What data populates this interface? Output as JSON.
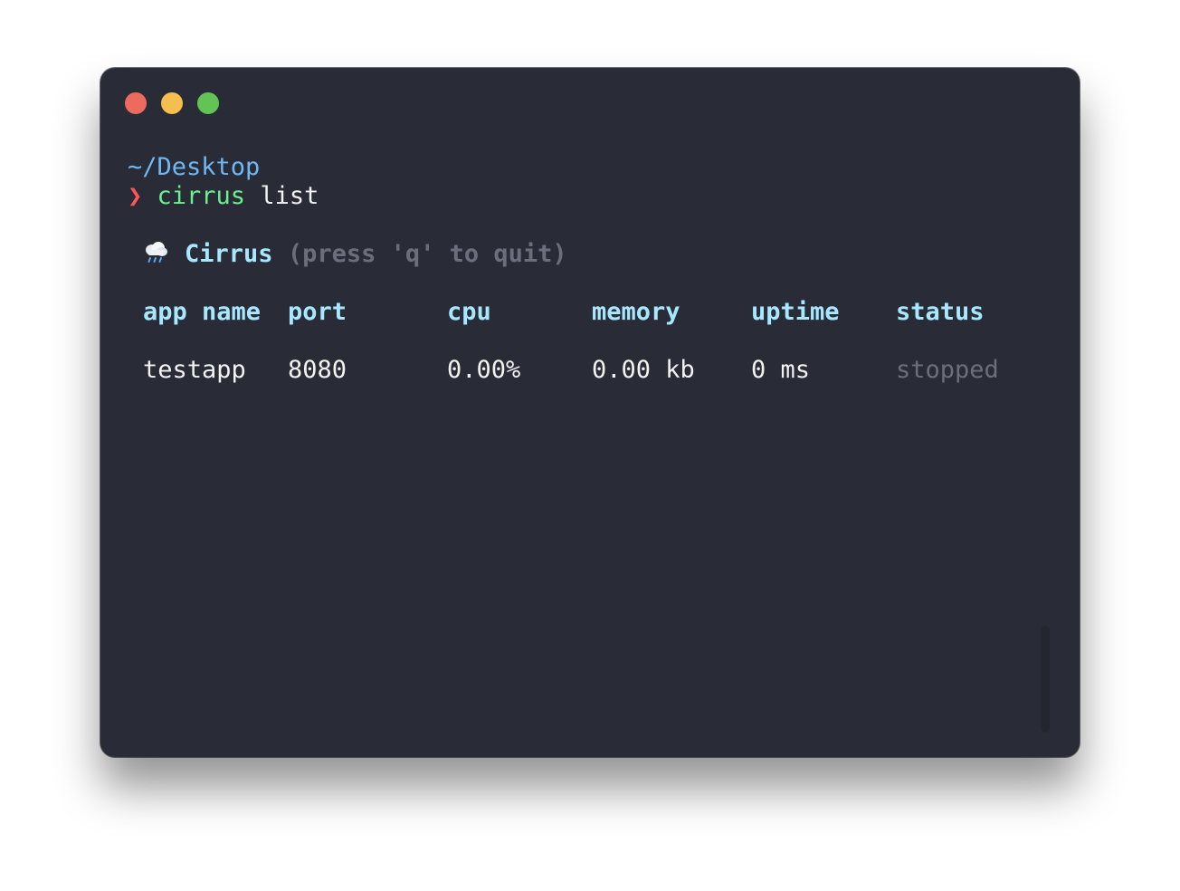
{
  "window": {
    "colors": {
      "background": "#292b37",
      "close": "#ed6a5e",
      "minimize": "#f5bf4f",
      "maximize": "#61c454"
    }
  },
  "terminal": {
    "cwd": "~/Desktop",
    "prompt_symbol": "❯",
    "command": "cirrus",
    "argument": "list"
  },
  "app": {
    "icon": "rain-cloud-icon",
    "title": "Cirrus",
    "hint": "(press 'q' to quit)"
  },
  "table": {
    "headers": [
      "app name",
      "port",
      "cpu",
      "memory",
      "uptime",
      "status"
    ],
    "rows": [
      [
        "testapp",
        "8080",
        "0.00%",
        "0.00 kb",
        "0 ms",
        "stopped"
      ]
    ]
  }
}
